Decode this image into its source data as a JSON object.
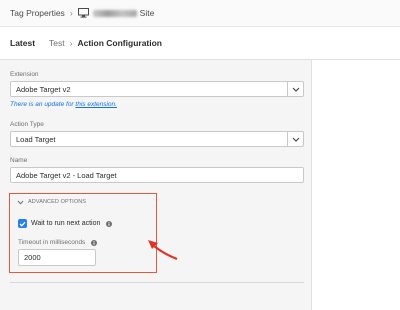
{
  "breadcrumb": {
    "root": "Tag Properties",
    "site_suffix": "Site"
  },
  "tabs": {
    "latest": "Latest",
    "test": "Test",
    "current": "Action Configuration"
  },
  "form": {
    "extension": {
      "label": "Extension",
      "value": "Adobe Target v2",
      "update_text": "There is an update for ",
      "update_link": "this extension."
    },
    "action_type": {
      "label": "Action Type",
      "value": "Load Target"
    },
    "name": {
      "label": "Name",
      "value": "Adobe Target v2 - Load Target"
    },
    "advanced": {
      "header": "ADVANCED OPTIONS",
      "wait_label": "Wait to run next action",
      "wait_checked": true,
      "timeout_label": "Timeout in milliseconds",
      "timeout_value": "2000"
    }
  },
  "colors": {
    "accent": "#2680eb",
    "link": "#1473e6",
    "highlight": "#e25a3c"
  },
  "icons": {
    "monitor": "monitor-icon",
    "chevron": "chevron-down-icon",
    "info": "info-icon",
    "check": "checkmark-icon",
    "arrow": "annotation-arrow-icon"
  }
}
